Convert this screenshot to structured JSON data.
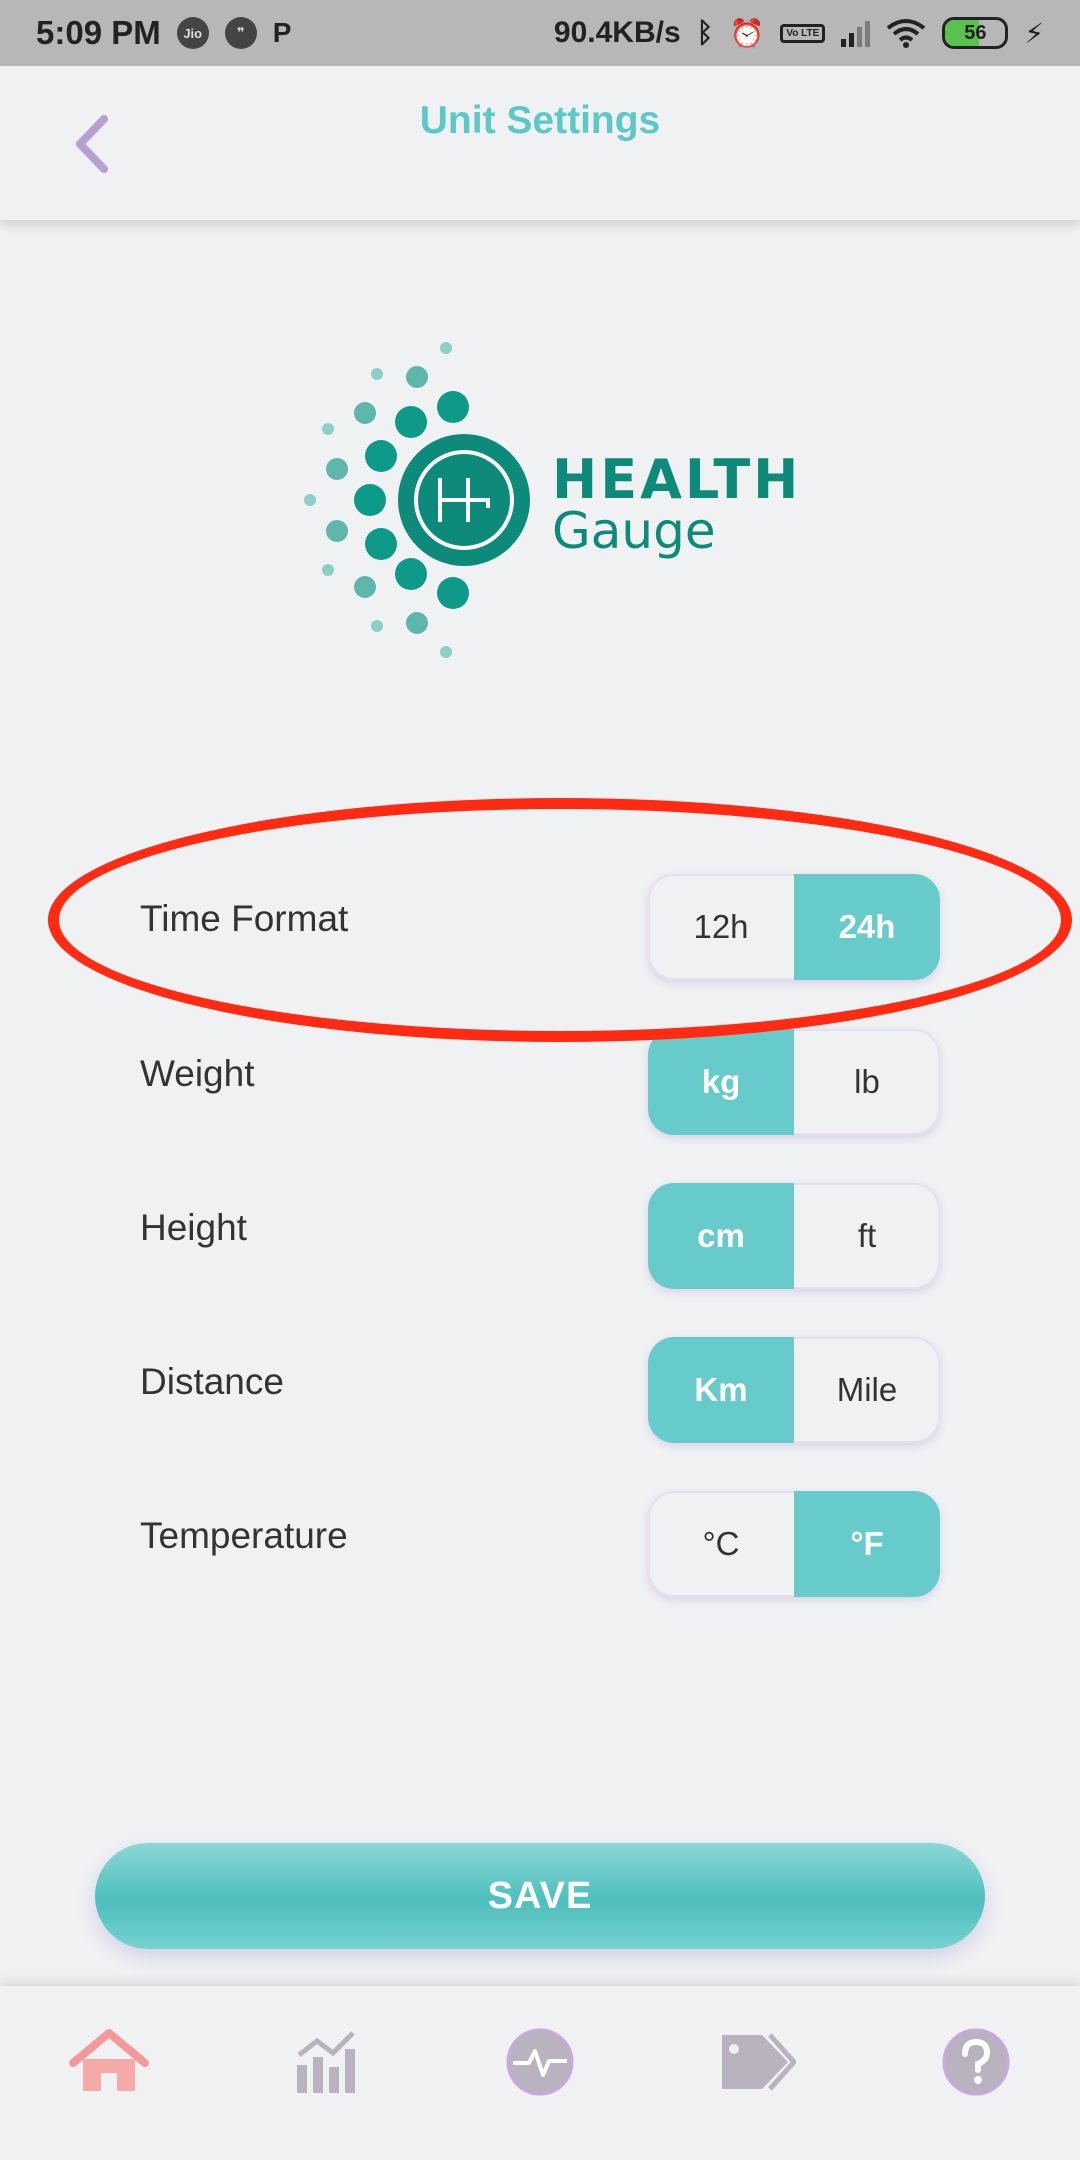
{
  "status_bar": {
    "time": "5:09 PM",
    "jio": "Jio",
    "network_speed": "90.4KB/s",
    "lte": "Vo LTE",
    "battery": "56"
  },
  "header": {
    "title": "Unit Settings",
    "back_icon": "chevron-left-icon"
  },
  "logo": {
    "brand_line1": "HEALTH",
    "brand_line2": "Gauge",
    "monogram": "HG"
  },
  "settings": {
    "time_format": {
      "label": "Time Format",
      "options": [
        "12h",
        "24h"
      ],
      "selected": "24h"
    },
    "weight": {
      "label": "Weight",
      "options": [
        "kg",
        "lb"
      ],
      "selected": "kg"
    },
    "height": {
      "label": "Height",
      "options": [
        "cm",
        "ft"
      ],
      "selected": "cm"
    },
    "distance": {
      "label": "Distance",
      "options": [
        "Km",
        "Mile"
      ],
      "selected": "Km"
    },
    "temperature": {
      "label": "Temperature",
      "options": [
        "°C",
        "°F"
      ],
      "selected": "°F"
    }
  },
  "save_label": "SAVE",
  "bottom_nav": {
    "items": [
      "home-icon",
      "stats-icon",
      "heartbeat-icon",
      "tags-icon",
      "help-icon"
    ],
    "active": "home-icon"
  },
  "colors": {
    "accent": "#68cbcb",
    "title": "#5dc8c8",
    "brand": "#0e8a7a",
    "highlight": "#ff2a12",
    "nav_active": "#f29a9a",
    "nav_inactive": "#b9b2bf"
  }
}
